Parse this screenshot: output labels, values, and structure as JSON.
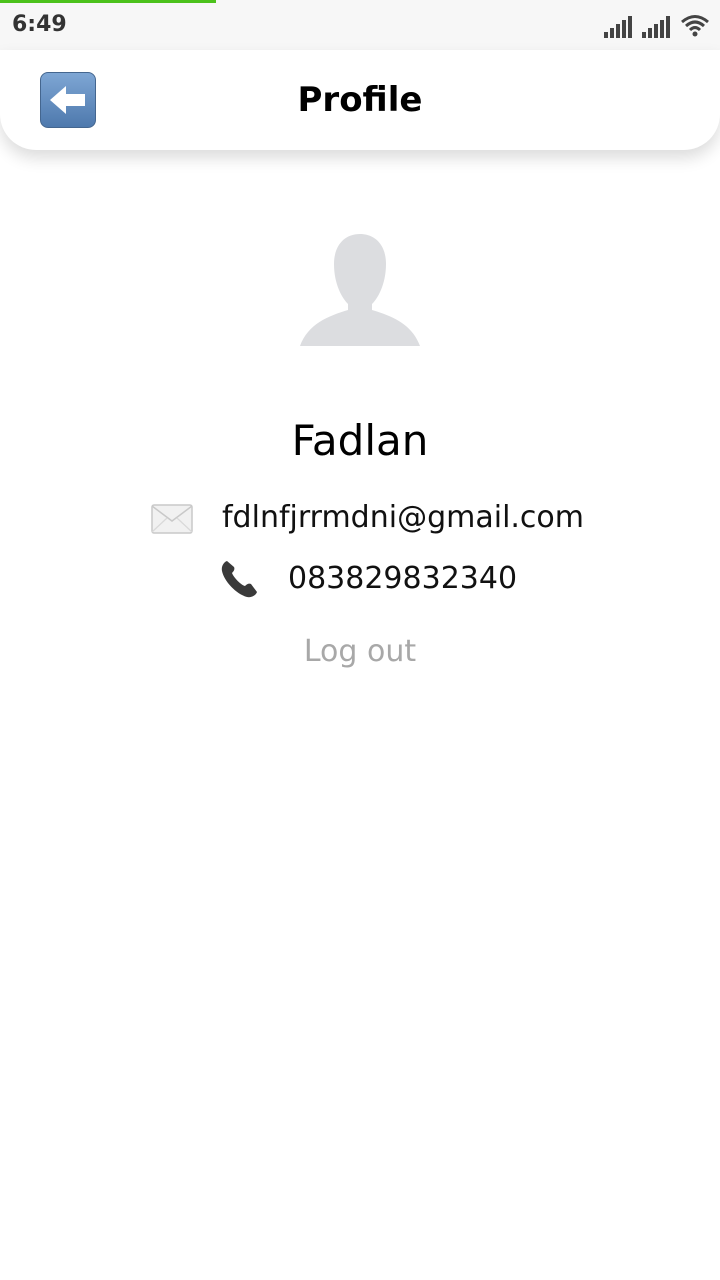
{
  "status_bar": {
    "time": "6:49",
    "icons": [
      "signal-icon",
      "signal-icon",
      "wifi-icon"
    ],
    "progress_color": "#4cc21c"
  },
  "header": {
    "title": "Profile",
    "back_icon": "back-arrow-icon"
  },
  "profile": {
    "name": "Fadlan",
    "email": "fdlnfjrrmdni@gmail.com",
    "phone": "083829832340",
    "logout_label": "Log out"
  },
  "colors": {
    "logout_text": "#a8a8a8",
    "avatar": "#dcdde0"
  }
}
